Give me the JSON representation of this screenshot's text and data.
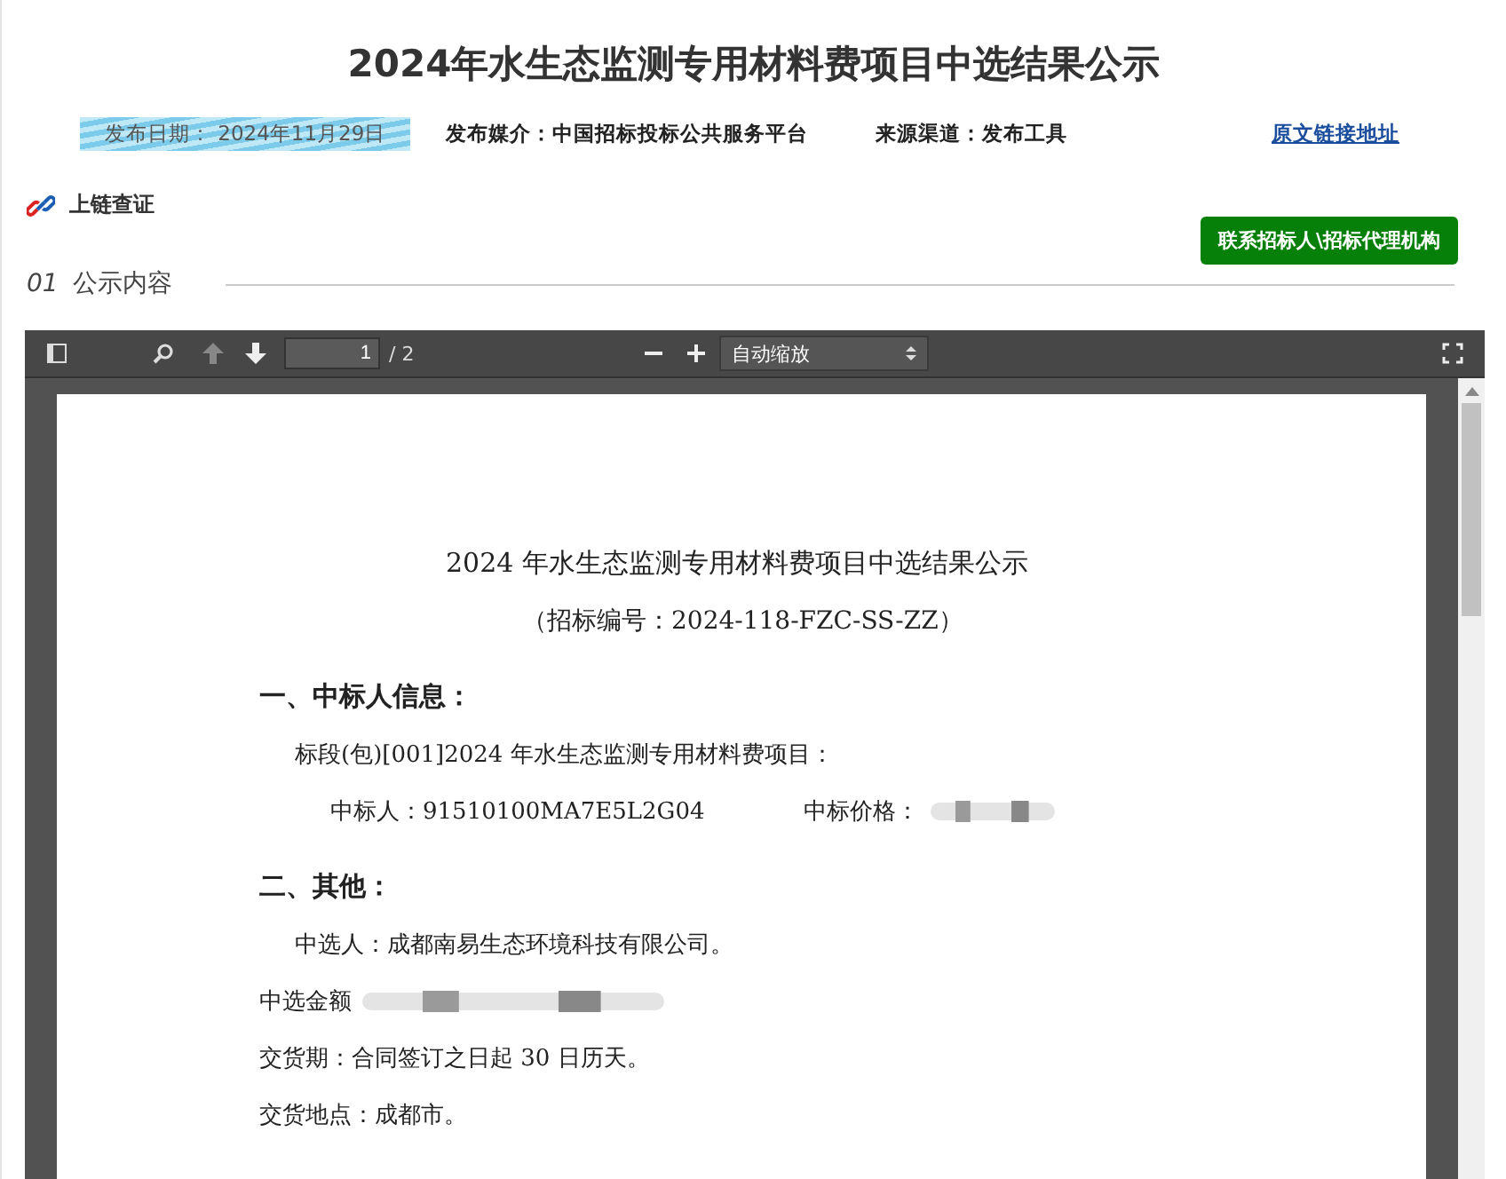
{
  "title": "2024年水生态监测专用材料费项目中选结果公示",
  "meta": {
    "date": "发布日期：  2024年11月29日",
    "media": "发布媒介：中国招标投标公共服务平台",
    "source": "来源渠道：发布工具",
    "link": "原文链接地址"
  },
  "chain": {
    "label": "上链查证"
  },
  "contact_button": "联系招标人\\招标代理机构",
  "section": {
    "number": "01",
    "title": "公示内容"
  },
  "viewer": {
    "page": "1",
    "total": "/ 2",
    "zoom": "自动缩放"
  },
  "document": {
    "title": "2024 年水生态监测专用材料费项目中选结果公示",
    "subtitle": "（招标编号：2024-118-FZC-SS-ZZ）",
    "lines": [
      {
        "kind": "heading",
        "text": "一、中标人信息："
      },
      {
        "kind": "indent",
        "text": "标段(包)[001]2024 年水生态监测专用材料费项目："
      },
      {
        "kind": "pair",
        "text": "中标人：91510100MA7E5L2G04",
        "second": "中标价格："
      },
      {
        "kind": "heading",
        "text": "二、其他："
      },
      {
        "kind": "indent",
        "text": "中选人：成都南易生态环境科技有限公司。"
      },
      {
        "kind": "redacted",
        "text": "中选金额"
      },
      {
        "kind": "plain",
        "text": "交货期：合同签订之日起 30 日历天。"
      },
      {
        "kind": "plain",
        "text": "交货地点：成都市。"
      }
    ]
  }
}
